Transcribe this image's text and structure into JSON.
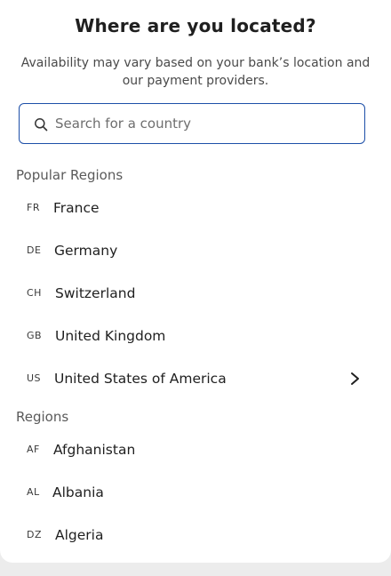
{
  "header": {
    "title": "Where are you located?",
    "subtitle": "Availability may vary based on your bank’s location and our payment providers."
  },
  "search": {
    "placeholder": "Search for a country",
    "value": ""
  },
  "popular": {
    "label": "Popular Regions",
    "items": [
      {
        "code": "FR",
        "name": "France"
      },
      {
        "code": "DE",
        "name": "Germany"
      },
      {
        "code": "CH",
        "name": "Switzerland"
      },
      {
        "code": "GB",
        "name": "United Kingdom"
      },
      {
        "code": "US",
        "name": "United States of America"
      }
    ]
  },
  "regions": {
    "label": "Regions",
    "items": [
      {
        "code": "AF",
        "name": "Afghanistan"
      },
      {
        "code": "AL",
        "name": "Albania"
      },
      {
        "code": "DZ",
        "name": "Algeria"
      }
    ]
  },
  "icons": {
    "search": "search-icon",
    "row_hover": "chevron-right-icon"
  },
  "colors": {
    "accent": "#1d4fa8"
  }
}
